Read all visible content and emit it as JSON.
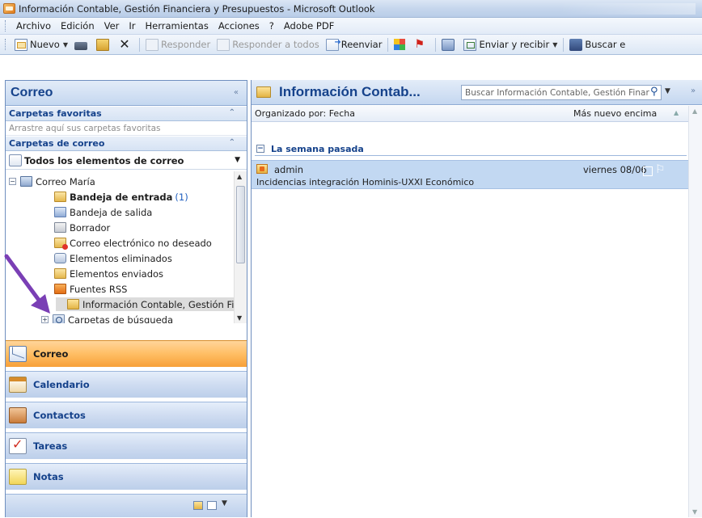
{
  "window": {
    "title": "Información Contable, Gestión Financiera y Presupuestos - Microsoft Outlook"
  },
  "menu": [
    "Archivo",
    "Edición",
    "Ver",
    "Ir",
    "Herramientas",
    "Acciones",
    "?",
    "Adobe PDF"
  ],
  "toolbar": {
    "new_label": "Nuevo",
    "reply_label": "Responder",
    "reply_all_label": "Responder a todos",
    "forward_label": "Reenviar",
    "send_receive_label": "Enviar y recibir",
    "search_label": "Buscar e"
  },
  "nav": {
    "header": "Correo",
    "collapse_glyph": "«",
    "favorites_title": "Carpetas favoritas",
    "favorites_hint": "Arrastre aquí sus carpetas favoritas",
    "mail_folders_title": "Carpetas de correo",
    "all_items_label": "Todos los elementos de correo",
    "tree": [
      {
        "label": "Correo María",
        "icon": "mailbox-icon"
      },
      {
        "label": "Bandeja de entrada",
        "count": "(1)",
        "icon": "inbox-icon"
      },
      {
        "label": "Bandeja de salida",
        "icon": "outbox-icon"
      },
      {
        "label": "Borrador",
        "icon": "drafts-icon"
      },
      {
        "label": "Correo electrónico no deseado",
        "icon": "junk-icon"
      },
      {
        "label": "Elementos eliminados",
        "icon": "deleted-icon"
      },
      {
        "label": "Elementos enviados",
        "icon": "sent-icon"
      },
      {
        "label": "Fuentes RSS",
        "icon": "rss-icon"
      },
      {
        "label": "Información Contable, Gestión Fin",
        "icon": "folder-icon"
      },
      {
        "label": "Carpetas de búsqueda",
        "icon": "search-folder-icon"
      }
    ],
    "buttons": [
      "Correo",
      "Calendario",
      "Contactos",
      "Tareas",
      "Notas"
    ]
  },
  "main": {
    "folder_title": "Información Contab...",
    "search_placeholder": "Buscar Información Contable, Gestión Finar",
    "arranged_by": "Organizado por: Fecha",
    "sort_order": "Más nuevo encima",
    "group_label": "La semana pasada",
    "messages": [
      {
        "sender": "admin",
        "subject": "Incidencias integración Hominis-UXXI Económico",
        "date": "viernes 08/06"
      }
    ]
  },
  "colors": {
    "header_text": "#15428b",
    "active_nav": "#ffbe64",
    "selected_message": "#c2d8f2",
    "annotation_arrow": "#7a3fb5"
  }
}
